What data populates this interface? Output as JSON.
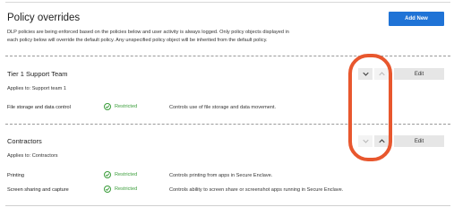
{
  "header": {
    "title": "Policy overrides",
    "add_button": "Add New",
    "description_line1": "DLP policies are being enforced based on the policies below and user activity is always logged. Only policy objects displayed in",
    "description_line2": "each policy below will override the default policy. Any unspecified policy object will be inherited from the default policy."
  },
  "groups": [
    {
      "title": "Tier 1 Support Team",
      "applies_label": "Applies to:",
      "applies_value": "Support team 1",
      "edit_label": "Edit",
      "move_down_enabled": true,
      "move_up_enabled": false,
      "rows": [
        {
          "name": "File storage and data control",
          "status": "Restricted",
          "description": "Controls use of file storage and data movement."
        }
      ]
    },
    {
      "title": "Contractors",
      "applies_label": "Applies to:",
      "applies_value": "Contractors",
      "edit_label": "Edit",
      "move_down_enabled": false,
      "move_up_enabled": true,
      "rows": [
        {
          "name": "Printing",
          "status": "Restricted",
          "description": "Controls printing from apps in Secure Enclave."
        },
        {
          "name": "Screen sharing and capture",
          "status": "Restricted",
          "description": "Controls ability to screen share or screenshot apps running in Secure Enclave."
        }
      ]
    }
  ],
  "colors": {
    "accent": "#1f73d6",
    "status_green": "#3a9d3a",
    "annotation": "#e8572e"
  },
  "icons": [
    "check-circle-icon",
    "chevron-down-icon",
    "chevron-up-icon"
  ]
}
